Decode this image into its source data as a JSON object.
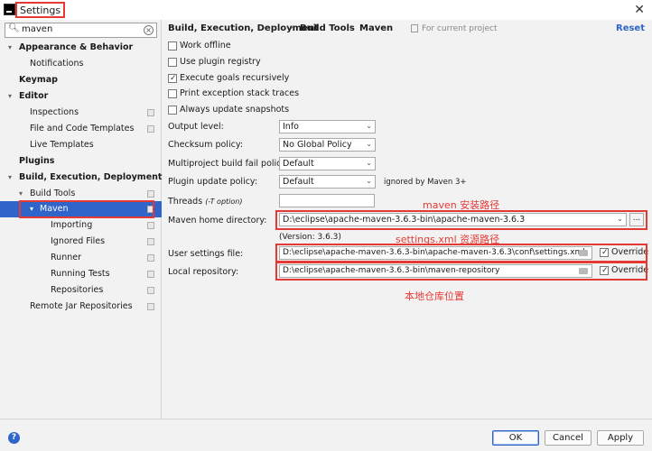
{
  "window": {
    "title": "Settings",
    "close_glyph": "✕"
  },
  "search": {
    "value": "maven",
    "icon": "search-icon",
    "clear_glyph": "×"
  },
  "sidebar": {
    "items": [
      {
        "label": "Appearance & Behavior",
        "arrow": "▾"
      },
      {
        "label": "Notifications"
      },
      {
        "label": "Keymap"
      },
      {
        "label": "Editor",
        "arrow": "▾"
      },
      {
        "label": "Inspections"
      },
      {
        "label": "File and Code Templates"
      },
      {
        "label": "Live Templates"
      },
      {
        "label": "Plugins"
      },
      {
        "label": "Build, Execution, Deployment",
        "arrow": "▾"
      },
      {
        "label": "Build Tools",
        "arrow": "▾"
      },
      {
        "label": "Maven",
        "arrow": "▾"
      },
      {
        "label": "Importing"
      },
      {
        "label": "Ignored Files"
      },
      {
        "label": "Runner"
      },
      {
        "label": "Running Tests"
      },
      {
        "label": "Repositories"
      },
      {
        "label": "Remote Jar Repositories"
      }
    ]
  },
  "header": {
    "crumbs": [
      "Build, Execution, Deployment",
      "Build Tools",
      "Maven"
    ],
    "separator": "›",
    "scope": "For current project",
    "reset": "Reset"
  },
  "options": [
    {
      "label": "Work offline",
      "checked": false
    },
    {
      "label": "Use plugin registry",
      "checked": false
    },
    {
      "label": "Execute goals recursively",
      "checked": true
    },
    {
      "label": "Print exception stack traces",
      "checked": false
    },
    {
      "label": "Always update snapshots",
      "checked": false
    }
  ],
  "fields": {
    "output_level": {
      "label": "Output level:",
      "value": "Info"
    },
    "checksum_policy": {
      "label": "Checksum policy:",
      "value": "No Global Policy"
    },
    "multiproject_fail": {
      "label": "Multiproject build fail policy:",
      "value": "Default"
    },
    "plugin_update": {
      "label": "Plugin update policy:",
      "value": "Default",
      "note": "ignored by Maven 3+"
    },
    "threads": {
      "label": "Threads",
      "hint": "(-T option)",
      "value": ""
    },
    "maven_home": {
      "label": "Maven home directory:",
      "value": "D:\\eclipse\\apache-maven-3.6.3-bin\\apache-maven-3.6.3",
      "version": "(Version: 3.6.3)",
      "browse": "..."
    },
    "user_settings": {
      "label": "User settings file:",
      "value": "D:\\eclipse\\apache-maven-3.6.3-bin\\apache-maven-3.6.3\\conf\\settings.xml",
      "override": "Override"
    },
    "local_repo": {
      "label": "Local repository:",
      "value": "D:\\eclipse\\apache-maven-3.6.3-bin\\maven-repository",
      "override": "Override"
    }
  },
  "annotations": {
    "maven_home": "maven 安装路径",
    "settings_xml": "settings.xml 资源路径",
    "local_repo": "本地仓库位置"
  },
  "footer": {
    "help": "?",
    "ok": "OK",
    "cancel": "Cancel",
    "apply": "Apply"
  },
  "colors": {
    "accent": "#2f65ca",
    "annotation": "#e53935"
  }
}
